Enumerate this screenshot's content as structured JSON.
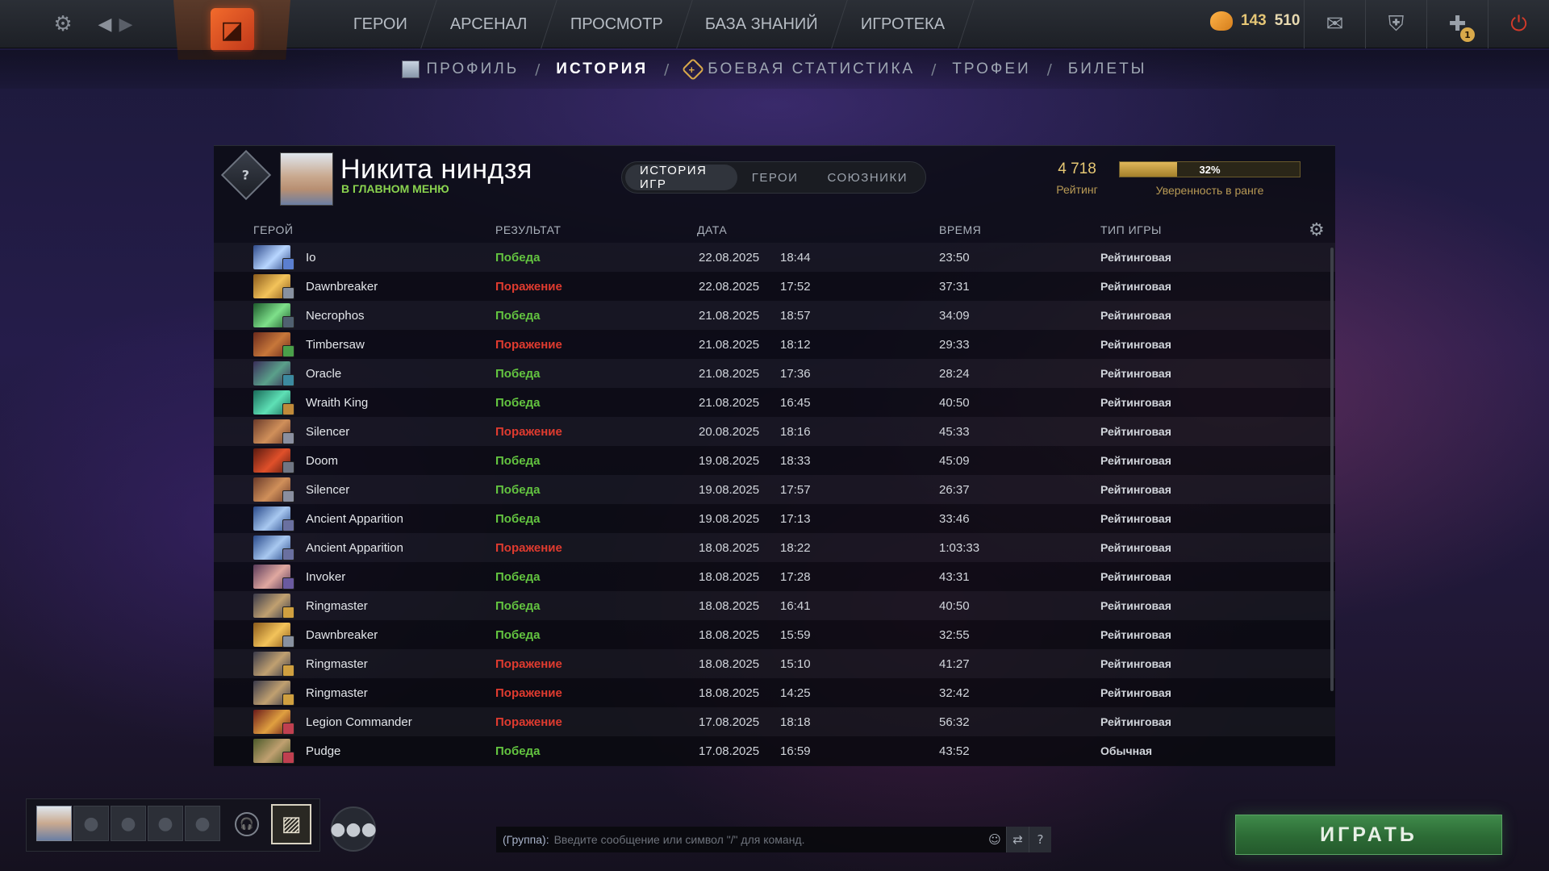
{
  "topbar": {
    "nav": [
      "ГЕРОИ",
      "АРСЕНАЛ",
      "ПРОСМОТР",
      "БАЗА ЗНАНИЙ",
      "ИГРОТЕКА"
    ],
    "gold": "143",
    "shards": "510",
    "notification_count": "1"
  },
  "subnav": {
    "profile": "ПРОФИЛЬ",
    "history": "ИСТОРИЯ",
    "battle_stats": "БОЕВАЯ СТАТИСТИКА",
    "trophies": "ТРОФЕИ",
    "tickets": "БИЛЕТЫ",
    "separator": "/"
  },
  "player": {
    "name": "Никита ниндзя",
    "status": "В ГЛАВНОМ МЕНЮ",
    "rank_symbol": "?"
  },
  "tabs": {
    "history": "ИСТОРИЯ ИГР",
    "heroes": "ГЕРОИ",
    "allies": "СОЮЗНИКИ"
  },
  "stats": {
    "rating_value": "4 718",
    "rating_label": "Рейтинг",
    "confidence_percent": 32,
    "confidence_text": "32%",
    "confidence_label": "Уверенность в ранге"
  },
  "columns": {
    "hero": "ГЕРОЙ",
    "result": "РЕЗУЛЬТАТ",
    "date": "ДАТА",
    "duration": "ВРЕМЯ",
    "type": "ТИП ИГРЫ"
  },
  "matches": [
    {
      "hero": "Io",
      "result": "Победа",
      "win": true,
      "date": "22.08.2025",
      "time": "18:44",
      "duration": "23:50",
      "type": "Рейтинговая",
      "c1": "#2f4a8a",
      "c2": "#b8d6ff",
      "c3": "#5b7fd0"
    },
    {
      "hero": "Dawnbreaker",
      "result": "Поражение",
      "win": false,
      "date": "22.08.2025",
      "time": "17:52",
      "duration": "37:31",
      "type": "Рейтинговая",
      "c1": "#8a5a1c",
      "c2": "#f3c35a",
      "c3": "#8891a0"
    },
    {
      "hero": "Necrophos",
      "result": "Победа",
      "win": true,
      "date": "21.08.2025",
      "time": "18:57",
      "duration": "34:09",
      "type": "Рейтинговая",
      "c1": "#1d5a2c",
      "c2": "#7ee08a",
      "c3": "#506070"
    },
    {
      "hero": "Timbersaw",
      "result": "Поражение",
      "win": false,
      "date": "21.08.2025",
      "time": "18:12",
      "duration": "29:33",
      "type": "Рейтинговая",
      "c1": "#6b2a1c",
      "c2": "#c7773a",
      "c3": "#4aa04a"
    },
    {
      "hero": "Oracle",
      "result": "Победа",
      "win": true,
      "date": "21.08.2025",
      "time": "17:36",
      "duration": "28:24",
      "type": "Рейтинговая",
      "c1": "#3a2e5a",
      "c2": "#5aa08a",
      "c3": "#3c8aa0"
    },
    {
      "hero": "Wraith King",
      "result": "Победа",
      "win": true,
      "date": "21.08.2025",
      "time": "16:45",
      "duration": "40:50",
      "type": "Рейтинговая",
      "c1": "#1a6a5a",
      "c2": "#5ee0b5",
      "c3": "#c08a3a"
    },
    {
      "hero": "Silencer",
      "result": "Поражение",
      "win": false,
      "date": "20.08.2025",
      "time": "18:16",
      "duration": "45:33",
      "type": "Рейтинговая",
      "c1": "#6a3a2a",
      "c2": "#d0905a",
      "c3": "#8a8fa0"
    },
    {
      "hero": "Doom",
      "result": "Победа",
      "win": true,
      "date": "19.08.2025",
      "time": "18:33",
      "duration": "45:09",
      "type": "Рейтинговая",
      "c1": "#5a1a10",
      "c2": "#e0502a",
      "c3": "#707684"
    },
    {
      "hero": "Silencer",
      "result": "Победа",
      "win": true,
      "date": "19.08.2025",
      "time": "17:57",
      "duration": "26:37",
      "type": "Рейтинговая",
      "c1": "#6a3a2a",
      "c2": "#d0905a",
      "c3": "#8a8fa0"
    },
    {
      "hero": "Ancient Apparition",
      "result": "Победа",
      "win": true,
      "date": "19.08.2025",
      "time": "17:13",
      "duration": "33:46",
      "type": "Рейтинговая",
      "c1": "#2a4a8a",
      "c2": "#a8c8f0",
      "c3": "#6a70a0"
    },
    {
      "hero": "Ancient Apparition",
      "result": "Поражение",
      "win": false,
      "date": "18.08.2025",
      "time": "18:22",
      "duration": "1:03:33",
      "type": "Рейтинговая",
      "c1": "#2a4a8a",
      "c2": "#a8c8f0",
      "c3": "#6a70a0"
    },
    {
      "hero": "Invoker",
      "result": "Победа",
      "win": true,
      "date": "18.08.2025",
      "time": "17:28",
      "duration": "43:31",
      "type": "Рейтинговая",
      "c1": "#5a3a5a",
      "c2": "#e0a8a0",
      "c3": "#6a5aa0"
    },
    {
      "hero": "Ringmaster",
      "result": "Победа",
      "win": true,
      "date": "18.08.2025",
      "time": "16:41",
      "duration": "40:50",
      "type": "Рейтинговая",
      "c1": "#3a3a4a",
      "c2": "#c0a070",
      "c3": "#d0a040"
    },
    {
      "hero": "Dawnbreaker",
      "result": "Победа",
      "win": true,
      "date": "18.08.2025",
      "time": "15:59",
      "duration": "32:55",
      "type": "Рейтинговая",
      "c1": "#8a5a1c",
      "c2": "#f3c35a",
      "c3": "#8891a0"
    },
    {
      "hero": "Ringmaster",
      "result": "Поражение",
      "win": false,
      "date": "18.08.2025",
      "time": "15:10",
      "duration": "41:27",
      "type": "Рейтинговая",
      "c1": "#3a3a4a",
      "c2": "#c0a070",
      "c3": "#d0a040"
    },
    {
      "hero": "Ringmaster",
      "result": "Поражение",
      "win": false,
      "date": "18.08.2025",
      "time": "14:25",
      "duration": "32:42",
      "type": "Рейтинговая",
      "c1": "#3a3a4a",
      "c2": "#c0a070",
      "c3": "#d0a040"
    },
    {
      "hero": "Legion Commander",
      "result": "Поражение",
      "win": false,
      "date": "17.08.2025",
      "time": "18:18",
      "duration": "56:32",
      "type": "Рейтинговая",
      "c1": "#6a1a1a",
      "c2": "#e0a040",
      "c3": "#c04050"
    },
    {
      "hero": "Pudge",
      "result": "Победа",
      "win": true,
      "date": "17.08.2025",
      "time": "16:59",
      "duration": "43:52",
      "type": "Обычная",
      "c1": "#4a5a2a",
      "c2": "#c0a070",
      "c3": "#c04050"
    }
  ],
  "chat": {
    "group_label": "(Группа):",
    "placeholder": "Введите сообщение или символ \"/\" для команд.",
    "help": "?"
  },
  "play_button": "ИГРАТЬ",
  "colors": {
    "win": "#63c440",
    "loss": "#df3b2f",
    "accent_gold": "#e7c874",
    "play_green": "#2c6b35"
  }
}
